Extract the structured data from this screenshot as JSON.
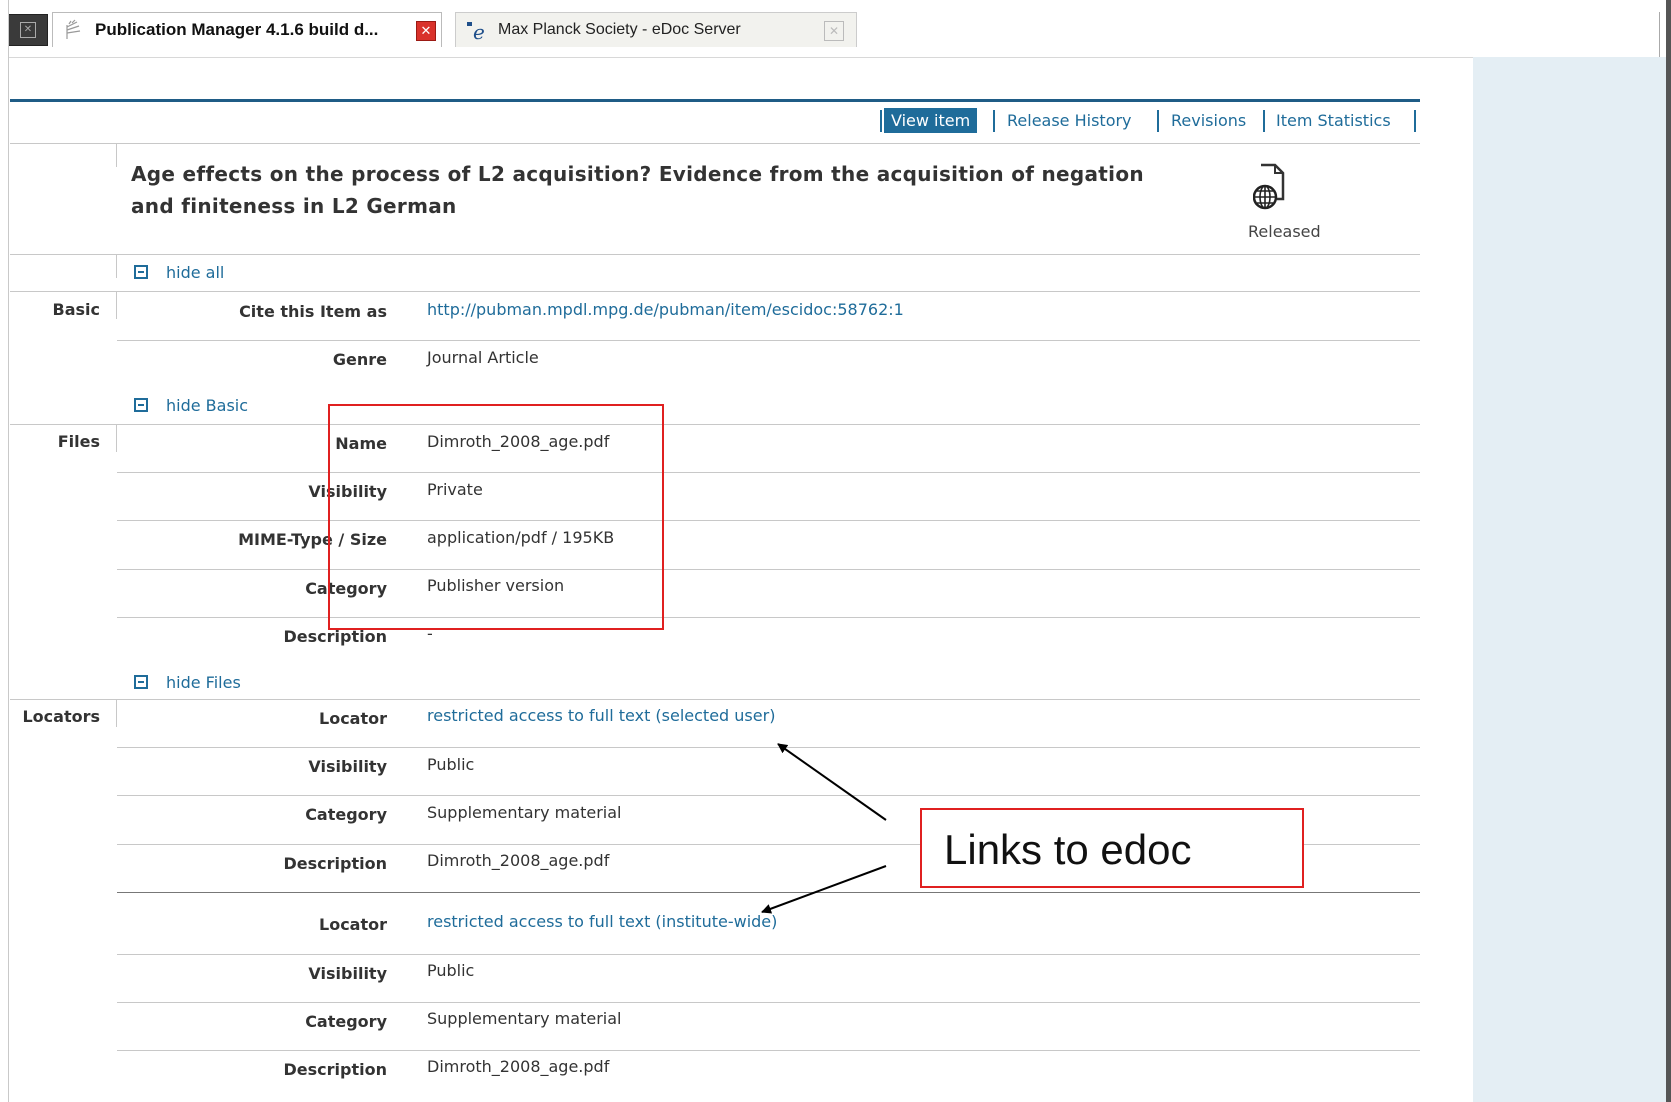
{
  "browser": {
    "tabs": [
      {
        "title": "Publication Manager 4.1.6 build d...",
        "active": true
      },
      {
        "title": "Max Planck Society - eDoc Server",
        "active": false
      }
    ]
  },
  "nav": {
    "items": [
      "View item",
      "Release History",
      "Revisions",
      "Item Statistics"
    ],
    "active": "View item"
  },
  "item": {
    "title_line1": "Age effects on the process of L2 acquisition? Evidence from the acquisition of negation",
    "title_line2": "and finiteness in L2 German",
    "status": "Released"
  },
  "toggles": {
    "hide_all": "hide all",
    "hide_basic": "hide Basic",
    "hide_files": "hide Files"
  },
  "sections": {
    "basic": {
      "heading": "Basic",
      "rows": [
        {
          "label": "Cite this Item as",
          "value": "http://pubman.mpdl.mpg.de/pubman/item/escidoc:58762:1",
          "link": true
        },
        {
          "label": "Genre",
          "value": "Journal Article",
          "link": false
        }
      ]
    },
    "files": {
      "heading": "Files",
      "rows": [
        {
          "label": "Name",
          "value": "Dimroth_2008_age.pdf"
        },
        {
          "label": "Visibility",
          "value": "Private"
        },
        {
          "label": "MIME-Type / Size",
          "value": "application/pdf / 195KB"
        },
        {
          "label": "Category",
          "value": "Publisher version"
        },
        {
          "label": "Description",
          "value": "-"
        }
      ]
    },
    "locators": {
      "heading": "Locators",
      "groups": [
        {
          "rows": [
            {
              "label": "Locator",
              "value": "restricted access to full text (selected user)",
              "link": true
            },
            {
              "label": "Visibility",
              "value": "Public",
              "link": false
            },
            {
              "label": "Category",
              "value": "Supplementary material",
              "link": false
            },
            {
              "label": "Description",
              "value": "Dimroth_2008_age.pdf",
              "link": false
            }
          ]
        },
        {
          "rows": [
            {
              "label": "Locator",
              "value": "restricted access to full text (institute-wide)",
              "link": true
            },
            {
              "label": "Visibility",
              "value": "Public",
              "link": false
            },
            {
              "label": "Category",
              "value": "Supplementary material",
              "link": false
            },
            {
              "label": "Description",
              "value": "Dimroth_2008_age.pdf",
              "link": false
            }
          ]
        }
      ]
    }
  },
  "annotation": {
    "callout_text": "Links to edoc"
  },
  "colors": {
    "accent": "#1f6c9a",
    "header_line": "#1f5c86",
    "annotation_red": "#e02020",
    "side_panel": "#e4eef4"
  }
}
